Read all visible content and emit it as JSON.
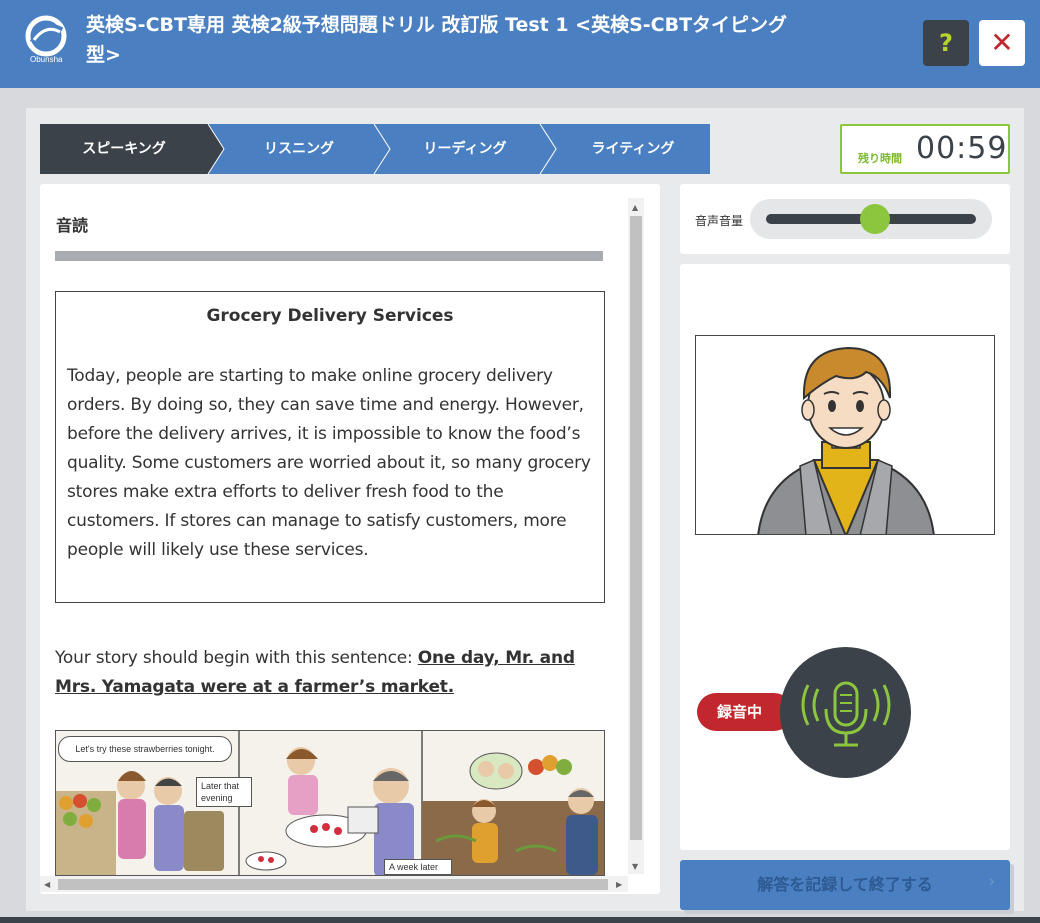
{
  "header": {
    "logo_text": "Obunsha",
    "title": "英検S-CBT専用 英検2級予想問題ドリル 改訂版 Test 1 <英検S-CBTタイピング型>",
    "help_label": "?",
    "close_label": "✕"
  },
  "tabs": [
    {
      "label": "スピーキング",
      "active": true
    },
    {
      "label": "リスニング",
      "active": false
    },
    {
      "label": "リーディング",
      "active": false
    },
    {
      "label": "ライティング",
      "active": false
    }
  ],
  "timer": {
    "label": "残り時間",
    "value": "00:59"
  },
  "section": {
    "title": "音読"
  },
  "passage": {
    "title": "Grocery Delivery Services",
    "body": "Today, people are starting to make online grocery delivery orders. By doing so, they can save time and energy. However, before the delivery arrives, it is impossible to know the food’s quality. Some customers are worried about it, so many grocery stores make extra efforts to deliver fresh food to the customers. If stores can manage to satisfy customers, more people will likely use these services."
  },
  "instruction": {
    "prefix": "Your story should begin with this sentence: ",
    "sentence": "One day, Mr. and Mrs. Yamagata were at a farmer’s market."
  },
  "comic": {
    "bubble1": "Let's try these strawberries tonight.",
    "caption1": "Later that evening",
    "caption2": "A week later"
  },
  "volume": {
    "label": "音声音量",
    "level": 0.52
  },
  "recording": {
    "label": "録音中"
  },
  "submit": {
    "label": "解答を記録して終了する"
  },
  "colors": {
    "header": "#4a7fc1",
    "accent_green": "#8cc63f",
    "dark": "#3b4249",
    "red": "#c0282e"
  }
}
